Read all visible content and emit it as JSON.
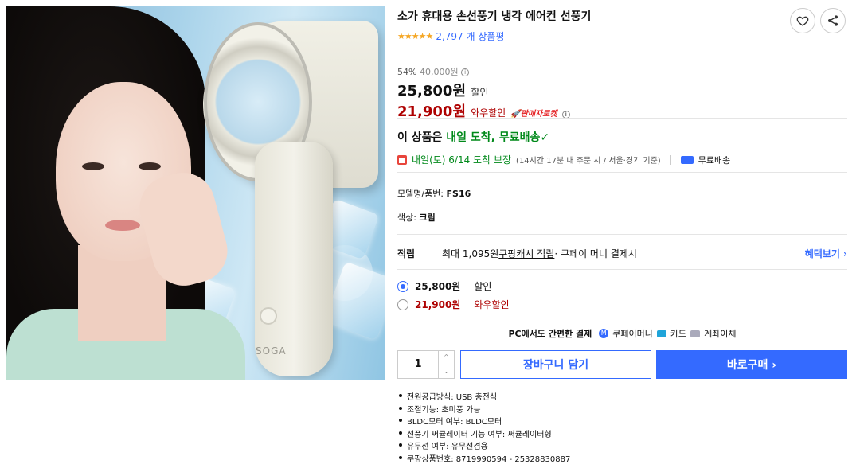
{
  "product": {
    "title": "소가 휴대용 손선풍기 냉각 에어컨 선풍기",
    "stars": "★★★★★",
    "review_count": "2,797 개 상품평",
    "image_logo": "SOGA"
  },
  "price": {
    "discount_rate": "54%",
    "original": "40,000원",
    "info_mark": "i",
    "sale": "25,800원",
    "sale_label": "할인",
    "wow": "21,900원",
    "wow_label": "와우할인",
    "rocket_badge": "🚀판매자로켓"
  },
  "delivery": {
    "headline_prefix": "이 상품은 ",
    "headline_highlight": "내일 도착, 무료배송",
    "check": "✓",
    "guarantee": "내일(토) 6/14 도착 보장",
    "guarantee_note": "(14시간 17분 내 주문 시 / 서울·경기 기준)",
    "shipping": "무료배송"
  },
  "specs": {
    "model_label": "모델명/품번: ",
    "model_value": "FS16",
    "color_label": "색상: ",
    "color_value": "크림"
  },
  "reward": {
    "label": "적립",
    "text_prefix": "최대 1,095원 ",
    "link": "쿠팡캐시 적립",
    "text_suffix": " · 쿠페이 머니 결제시",
    "benefit": "혜택보기 ›"
  },
  "options": [
    {
      "value": "25,800원",
      "label": "할인",
      "selected": true
    },
    {
      "value": "21,900원",
      "label": "와우할인",
      "selected": false
    }
  ],
  "payment": {
    "lead": "PC에서도 간편한 결제",
    "money_mark": "M",
    "money": "쿠페이머니",
    "card": "카드",
    "account": "계좌이체"
  },
  "purchase": {
    "quantity": "1",
    "up": "^",
    "down": "⌄",
    "cart": "장바구니 담기",
    "buy": "바로구매 ›"
  },
  "attributes": [
    "전원공급방식: USB 충전식",
    "조절기능: 초미풍 가능",
    "BLDC모터 여부: BLDC모터",
    "선풍기 써큘레이터 기능 여부: 써큘레이터형",
    "유무선 여부: 유무선겸용",
    "쿠팡상품번호: 8719990594 - 25328830887"
  ],
  "colors": {
    "accent": "#346aff",
    "wow_red": "#ae0000",
    "delivery_green": "#00891a",
    "star": "#f5a623"
  },
  "icons": [
    "heart-icon",
    "share-icon",
    "info-icon",
    "calendar-icon",
    "truck-icon",
    "chevron-up-icon",
    "chevron-down-icon"
  ]
}
